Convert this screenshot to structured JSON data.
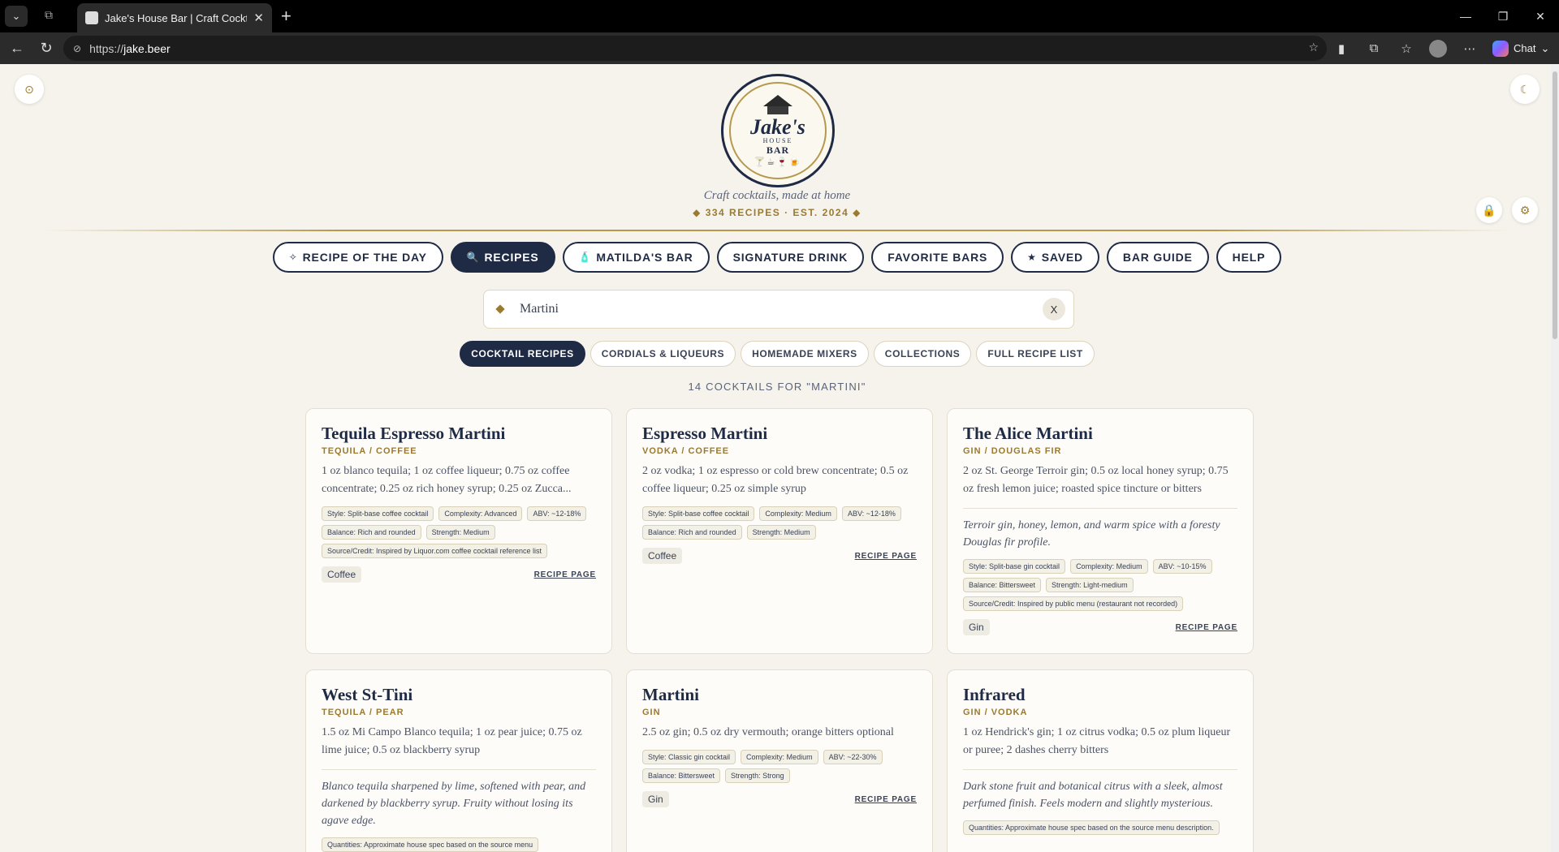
{
  "browser": {
    "tab_title": "Jake's House Bar | Craft Cocktail Re",
    "tab_close": "✕",
    "new_tab": "+",
    "url_prefix": "https://",
    "url_host": "jake.beer",
    "chat_label": "Chat",
    "window_controls": [
      "—",
      "❐",
      "✕"
    ]
  },
  "header": {
    "logo_text": "Jake's",
    "logo_house": "HOUSE",
    "logo_bar": "BAR",
    "logo_glasses": "🍸☕🍷🍺",
    "tagline": "Craft cocktails, made at home",
    "meta": "◆ 334 RECIPES · EST. 2024 ◆"
  },
  "nav": [
    {
      "label": "RECIPE OF THE DAY",
      "icon": "✧",
      "active": false
    },
    {
      "label": "RECIPES",
      "icon": "🔍",
      "active": true
    },
    {
      "label": "MATILDA'S BAR",
      "icon": "🧴",
      "active": false
    },
    {
      "label": "SIGNATURE DRINK",
      "icon": "",
      "active": false
    },
    {
      "label": "FAVORITE BARS",
      "icon": "",
      "active": false
    },
    {
      "label": "SAVED",
      "icon": "★",
      "active": false
    },
    {
      "label": "BAR GUIDE",
      "icon": "",
      "active": false
    },
    {
      "label": "HELP",
      "icon": "",
      "active": false
    }
  ],
  "search": {
    "value": "Martini",
    "clear_label": "X"
  },
  "subnav": [
    {
      "label": "COCKTAIL RECIPES",
      "active": true
    },
    {
      "label": "CORDIALS & LIQUEURS",
      "active": false
    },
    {
      "label": "HOMEMADE MIXERS",
      "active": false
    },
    {
      "label": "COLLECTIONS",
      "active": false
    },
    {
      "label": "FULL RECIPE LIST",
      "active": false
    }
  ],
  "result_count": "14 COCKTAILS FOR \"MARTINI\"",
  "corner": {
    "left_icon": "⊙",
    "right_icon": "☾",
    "lock_icon": "🔒",
    "gear_icon": "⚙"
  },
  "recipe_link_label": "RECIPE PAGE",
  "cards": [
    {
      "title": "Tequila Espresso Martini",
      "category": "TEQUILA / COFFEE",
      "spec": "1 oz blanco tequila; 1 oz coffee liqueur; 0.75 oz coffee concentrate; 0.25 oz rich honey syrup; 0.25 oz Zucca...",
      "desc": "",
      "tags": [
        "Style: Split-base coffee cocktail",
        "Complexity: Advanced",
        "ABV: ~12-18%",
        "Balance: Rich and rounded",
        "Strength: Medium",
        "Source/Credit: Inspired by Liquor.com coffee cocktail reference list"
      ],
      "chip": "Coffee"
    },
    {
      "title": "Espresso Martini",
      "category": "VODKA / COFFEE",
      "spec": "2 oz vodka; 1 oz espresso or cold brew concentrate; 0.5 oz coffee liqueur; 0.25 oz simple syrup",
      "desc": "",
      "tags": [
        "Style: Split-base coffee cocktail",
        "Complexity: Medium",
        "ABV: ~12-18%",
        "Balance: Rich and rounded",
        "Strength: Medium"
      ],
      "chip": "Coffee"
    },
    {
      "title": "The Alice Martini",
      "category": "GIN / DOUGLAS FIR",
      "spec": "2 oz St. George Terroir gin; 0.5 oz local honey syrup; 0.75 oz fresh lemon juice; roasted spice tincture or bitters",
      "desc": "Terroir gin, honey, lemon, and warm spice with a foresty Douglas fir profile.",
      "tags": [
        "Style: Split-base gin cocktail",
        "Complexity: Medium",
        "ABV: ~10-15%",
        "Balance: Bittersweet",
        "Strength: Light-medium",
        "Source/Credit: Inspired by public menu (restaurant not recorded)"
      ],
      "chip": "Gin"
    },
    {
      "title": "West St-Tini",
      "category": "TEQUILA / PEAR",
      "spec": "1.5 oz Mi Campo Blanco tequila; 1 oz pear juice; 0.75 oz lime juice; 0.5 oz blackberry syrup",
      "desc": "Blanco tequila sharpened by lime, softened with pear, and darkened by blackberry syrup. Fruity without losing its agave edge.",
      "tags": [
        "Quantities: Approximate house spec based on the source menu"
      ],
      "chip": ""
    },
    {
      "title": "Martini",
      "category": "GIN",
      "spec": "2.5 oz gin; 0.5 oz dry vermouth; orange bitters optional",
      "desc": "",
      "tags": [
        "Style: Classic gin cocktail",
        "Complexity: Medium",
        "ABV: ~22-30%",
        "Balance: Bittersweet",
        "Strength: Strong"
      ],
      "chip": "Gin"
    },
    {
      "title": "Infrared",
      "category": "GIN / VODKA",
      "spec": "1 oz Hendrick's gin; 1 oz citrus vodka; 0.5 oz plum liqueur or puree; 2 dashes cherry bitters",
      "desc": "Dark stone fruit and botanical citrus with a sleek, almost perfumed finish. Feels modern and slightly mysterious.",
      "tags": [
        "Quantities: Approximate house spec based on the source menu description."
      ],
      "chip": ""
    }
  ]
}
